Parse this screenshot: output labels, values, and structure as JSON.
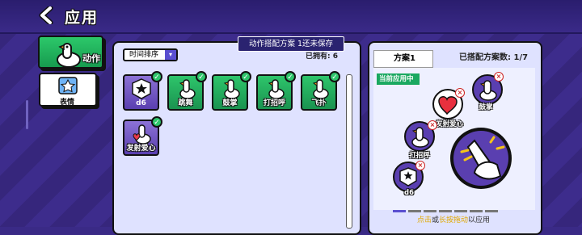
{
  "header": {
    "title": "应用"
  },
  "sidebar": {
    "items": [
      {
        "label": "动作"
      },
      {
        "label": "表情"
      }
    ]
  },
  "toast": "动作搭配方案 1还未保存",
  "left_panel": {
    "sort_label": "时间排序",
    "owned_text": "已拥有: 6",
    "cards": [
      {
        "label": "d6",
        "style": "purple",
        "icon": "dice-icon"
      },
      {
        "label": "跳舞",
        "style": "green",
        "icon": "goose-icon"
      },
      {
        "label": "鼓掌",
        "style": "green",
        "icon": "goose-icon"
      },
      {
        "label": "打招呼",
        "style": "green",
        "icon": "goose-icon"
      },
      {
        "label": "飞扑",
        "style": "green",
        "icon": "goose-icon"
      },
      {
        "label": "发射爱心",
        "style": "purple",
        "icon": "goose-icon"
      }
    ]
  },
  "right_panel": {
    "tab_label": "方案1",
    "count_text": "已搭配方案数: 1/7",
    "current_badge": "当前应用中",
    "slots": [
      {
        "label": "鼓掌"
      },
      {
        "label": "发射爱心"
      },
      {
        "label": "打招呼"
      },
      {
        "label": "d6"
      }
    ],
    "hint_a": "点击",
    "hint_b": "或",
    "hint_c": "长按拖动",
    "hint_d": "以应用"
  },
  "colors": {
    "accent_green": "#2ec56b",
    "purple": "#5a3fb0",
    "bg": "#3a2a86"
  }
}
